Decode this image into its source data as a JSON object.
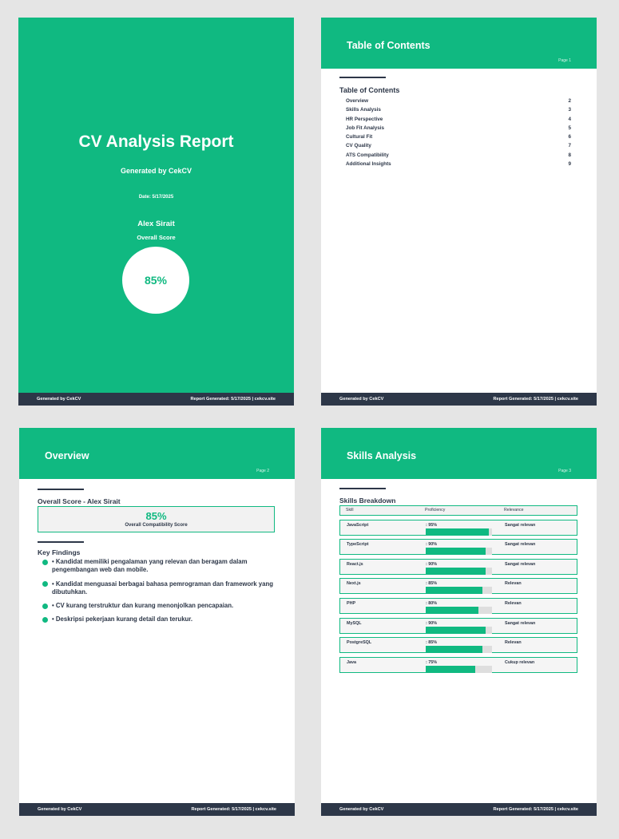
{
  "footer": {
    "left": "Generated by CekCV",
    "right": "Report Generated: 5/17/2025 | cekcv.site"
  },
  "cover": {
    "title": "CV Analysis Report",
    "generated_by": "Generated by CekCV",
    "date": "Date: 5/17/2025",
    "name": "Alex Sirait",
    "overall_label": "Overall Score",
    "score": "85%"
  },
  "toc": {
    "header": "Table of Contents",
    "page_label": "Page 1",
    "title": "Table of Contents",
    "items": [
      {
        "label": "Overview",
        "page": "2"
      },
      {
        "label": "Skills Analysis",
        "page": "3"
      },
      {
        "label": "HR Perspective",
        "page": "4"
      },
      {
        "label": "Job Fit Analysis",
        "page": "5"
      },
      {
        "label": "Cultural Fit",
        "page": "6"
      },
      {
        "label": "CV Quality",
        "page": "7"
      },
      {
        "label": "ATS Compatibility",
        "page": "8"
      },
      {
        "label": "Additional Insights",
        "page": "9"
      }
    ]
  },
  "overview": {
    "header": "Overview",
    "page_label": "Page 2",
    "score_heading": "Overall Score - Alex Sirait",
    "score": "85%",
    "score_label": "Overall Compatibility Score",
    "findings_heading": "Key Findings",
    "findings": [
      "• Kandidat memiliki pengalaman yang relevan dan beragam dalam pengembangan web dan mobile.",
      "• Kandidat menguasai berbagai bahasa pemrograman dan framework yang dibutuhkan.",
      "• CV kurang terstruktur dan kurang menonjolkan pencapaian.",
      "• Deskripsi pekerjaan kurang detail dan terukur."
    ]
  },
  "skills": {
    "header": "Skills Analysis",
    "page_label": "Page 3",
    "heading": "Skills Breakdown",
    "columns": {
      "skill": "Skill",
      "proficiency": "Proficiency",
      "relevance": "Relevance"
    },
    "rows": [
      {
        "skill": "JavaScript",
        "proficiency_text": ": 95%",
        "proficiency": 95,
        "relevance": "Sangat relevan"
      },
      {
        "skill": "TypeScript",
        "proficiency_text": ": 90%",
        "proficiency": 90,
        "relevance": "Sangat relevan"
      },
      {
        "skill": "React.js",
        "proficiency_text": ": 90%",
        "proficiency": 90,
        "relevance": "Sangat relevan"
      },
      {
        "skill": "Next.js",
        "proficiency_text": ": 85%",
        "proficiency": 85,
        "relevance": "Relevan"
      },
      {
        "skill": "PHP",
        "proficiency_text": ": 80%",
        "proficiency": 80,
        "relevance": "Relevan"
      },
      {
        "skill": "MySQL",
        "proficiency_text": ": 90%",
        "proficiency": 90,
        "relevance": "Sangat relevan"
      },
      {
        "skill": "PostgreSQL",
        "proficiency_text": ": 85%",
        "proficiency": 85,
        "relevance": "Relevan"
      },
      {
        "skill": "Java",
        "proficiency_text": ": 75%",
        "proficiency": 75,
        "relevance": "Cukup relevan"
      }
    ]
  },
  "colors": {
    "accent": "#10b981",
    "footer": "#2d3748",
    "background": "#e5e5e5"
  }
}
